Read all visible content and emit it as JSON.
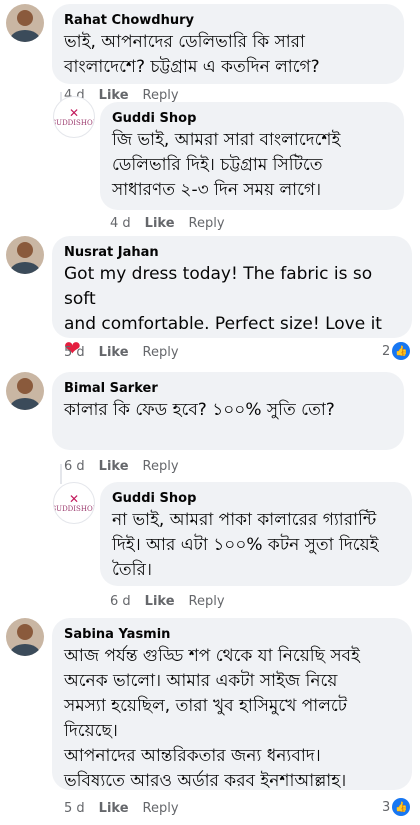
{
  "comments": [
    {
      "author": "Rahat Chowdhury",
      "text": "ভাই, আপনাদের ডেলিভারি কি সারা\nবাংলাদেশে? চট্টগ্রাম এ কতদিন লাগে?",
      "time": "4 d",
      "like": "Like",
      "reply": "Reply"
    },
    {
      "author": "Guddi Shop",
      "text": "জি ভাই, আমরা সারা বাংলাদেশেই\nডেলিভারি দিই। চট্টগ্রাম সিটিতে\nসাধারণত ২-৩ দিন সময় লাগে।",
      "time": "4 d",
      "like": "Like",
      "reply": "Reply"
    },
    {
      "author": "Nusrat Jahan",
      "text": "Got my dress today! The fabric is so soft\nand comfortable. Perfect size! Love it",
      "emoji": "❤",
      "time": "5 d",
      "like": "Like",
      "reply": "Reply",
      "reactions": "2"
    },
    {
      "author": "Bimal Sarker",
      "text": "কালার কি ফেড হবে? ১০০% সুতি তো?",
      "time": "6 d",
      "like": "Like",
      "reply": "Reply"
    },
    {
      "author": "Guddi Shop",
      "text": "না ভাই, আমরা পাকা কালারের গ্যারান্টি\nদিই। আর এটা ১০০% কটন সুতা দিয়েই\nতৈরি।",
      "time": "6 d",
      "like": "Like",
      "reply": "Reply"
    },
    {
      "author": "Sabina Yasmin",
      "text": "আজ পর্যন্ত গুড্ডি শপ থেকে যা নিয়েছি সবই\nঅনেক ভালো। আমার একটা সাইজ নিয়ে\nসমস্যা হয়েছিল, তারা খুব হাসিমুখে পালটে\nদিয়েছে।\nআপনাদের আন্তরিকতার জন্য ধন্যবাদ।\nভবিষ্যতে আরও অর্ডার করব ইনশাআল্লাহ।",
      "time": "5 d",
      "like": "Like",
      "reply": "Reply",
      "reactions": "3"
    }
  ],
  "shop_logo_text": "GUDDISHOP"
}
